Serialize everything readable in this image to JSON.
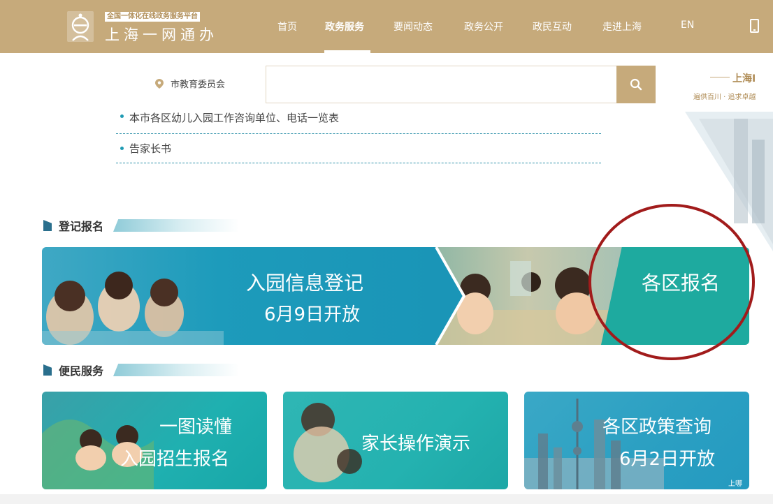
{
  "header": {
    "logo_tag": "全国一体化在线政务服务平台",
    "logo_name": "上海一网通办",
    "nav": [
      {
        "label": "首页"
      },
      {
        "label": "政务服务"
      },
      {
        "label": "要闻动态"
      },
      {
        "label": "政务公开"
      },
      {
        "label": "政民互动"
      },
      {
        "label": "走进上海"
      },
      {
        "label": "EN"
      }
    ],
    "active_nav": "政务服务",
    "icons": [
      "logo-icon",
      "mobile-icon"
    ]
  },
  "search": {
    "location": "市教育委员会",
    "value": "",
    "icons": [
      "location-pin-icon",
      "search-icon"
    ]
  },
  "side_promo": {
    "title": "上海I",
    "subtitle": "遍供百川 · 追求卓越"
  },
  "doc_list": [
    {
      "label": "本市各区幼儿入园工作咨询单位、电话一览表"
    },
    {
      "label": "告家长书"
    }
  ],
  "sections": {
    "register": "登记报名",
    "services": "便民服务"
  },
  "banner": {
    "line1": "入园信息登记",
    "line2": "6月9日开放",
    "right_label": "各区报名"
  },
  "cards": [
    {
      "line1": "一图读懂",
      "line2": "入园招生报名"
    },
    {
      "line1": "家长操作演示",
      "line2": ""
    },
    {
      "line1": "各区政策查询",
      "line2": "6月2日开放"
    }
  ],
  "corner_label": "上哪",
  "colors": {
    "header_bg": "#c6aa7b",
    "accent_teal": "#1d9bbb",
    "annotation": "#a11b1b"
  }
}
